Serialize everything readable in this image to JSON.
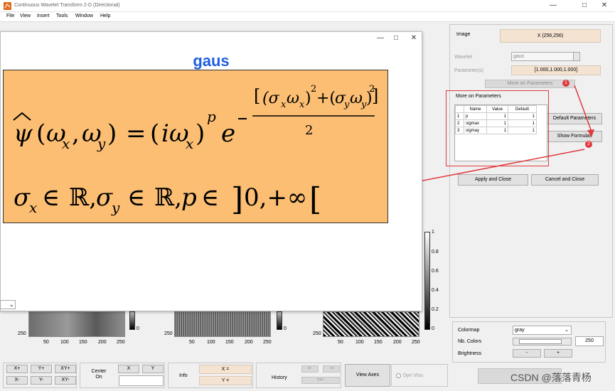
{
  "window": {
    "title": "Continuous Wavelet Transform 2-D (Directional)",
    "minimize": "—",
    "maximize": "□",
    "close": "✕"
  },
  "menu": [
    "File",
    "View",
    "Insert",
    "Tools",
    "Window",
    "Help"
  ],
  "right_panel": {
    "image_label": "Image",
    "image_value": "X  (256,256)",
    "wavelet_label": "Wavelet",
    "wavelet_value": "gaus",
    "parameters_label": "Parameter(s)",
    "parameters_value": "[1.000,1.000,1.000]",
    "more_params_button": "More on Parameters",
    "default_params_button": "Default Parameters",
    "show_formulas_button": "Show Formulas",
    "apply_close_button": "Apply and Close",
    "cancel_close_button": "Cancel and Close",
    "colormap_label": "Colormap",
    "colormap_value": "gray",
    "nb_colors_label": "Nb. Colors",
    "nb_colors_value": "250",
    "brightness_label": "Brightness",
    "brightness_minus": "-",
    "brightness_plus": "+"
  },
  "param_dialog": {
    "title": "More on Parameters",
    "headers": [
      "",
      "Name",
      "Value",
      "Default"
    ],
    "rows": [
      [
        "1",
        "p",
        "1",
        "1"
      ],
      [
        "2",
        "sigmax",
        "1",
        "1"
      ],
      [
        "3",
        "sigmay",
        "1",
        "1"
      ]
    ]
  },
  "badges": [
    "1",
    "2"
  ],
  "formula_dialog": {
    "title": "gaus",
    "formula_bg": "#fbbe73",
    "minimize": "—",
    "maximize": "□",
    "close": "✕"
  },
  "axes": {
    "x_ticks": [
      "50",
      "100",
      "150",
      "200",
      "250"
    ],
    "y_tick": "250",
    "colorbar_ticks": [
      "1",
      "0.8",
      "0.6",
      "0.4",
      "0.2",
      "0"
    ],
    "colorbar_zero": "0"
  },
  "bottom": {
    "x_plus": "X+",
    "y_plus": "Y+",
    "xy_plus": "XY+",
    "x_minus": "X-",
    "y_minus": "Y-",
    "xy_minus": "XY-",
    "center_on": "Center\nOn",
    "x_btn": "X",
    "y_btn": "Y",
    "info": "Info",
    "x_eq": "X =",
    "y_eq": "Y =",
    "history": "History",
    "hist_back": "<-",
    "hist_fwd": "->",
    "hist_reset": "<<-",
    "view_axes": "View Axes",
    "dyn_visu": "Dyn Visu"
  },
  "watermark": "CSDN @落落青杨",
  "colors": {
    "accent_red": "#e0393e",
    "title_blue": "#1f5fe0",
    "field_tan": "#f5e3d2"
  }
}
